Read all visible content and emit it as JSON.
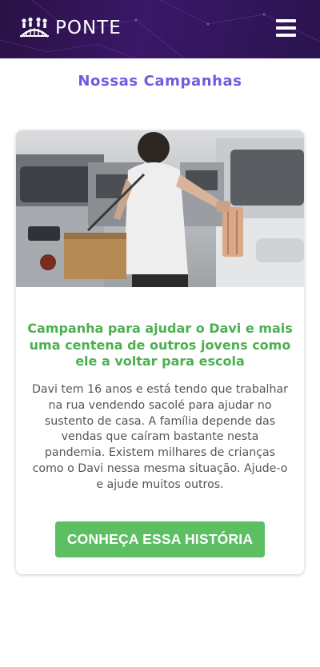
{
  "header": {
    "brand_name": "PONTE",
    "brand_icon": "people-bridge-logo",
    "menu_icon": "hamburger-menu-icon"
  },
  "page": {
    "title": "Nossas Campanhas"
  },
  "campaign": {
    "image_alt": "boy-selling-bags-between-cars-photo",
    "title": "Campanha para ajudar o Davi e mais uma centena de outros jovens como ele a voltar para escola",
    "description": "Davi tem 16 anos e está tendo que trabalhar na rua vendendo sacolé para ajudar no sustento de casa. A família depende das vendas que caíram bastante nesta pandemia. Existem milhares de crianças como o Davi nessa mesma situação. Ajude-o e ajude muitos outros.",
    "cta_label": "CONHEÇA ESSA HISTÓRIA"
  },
  "colors": {
    "header_bg": "#2f1358",
    "title": "#6b5ce0",
    "campaign_title": "#4caf50",
    "cta_bg": "#5cbf62"
  }
}
